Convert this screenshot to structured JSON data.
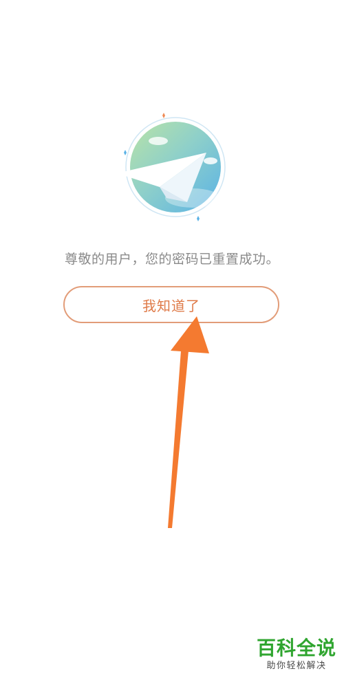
{
  "dialog": {
    "message": "尊敬的用户，您的密码已重置成功。",
    "confirm_label": "我知道了"
  },
  "watermark": {
    "title": "百科全说",
    "subtitle": "助你轻松解决"
  },
  "colors": {
    "accent": "#df7a48",
    "button_border": "#e29c78",
    "message_text": "#8a8a8a",
    "annotation_arrow": "#f47a30",
    "watermark_green": "#2fa52f"
  },
  "icons": {
    "illustration": "paper-plane-globe-icon",
    "annotation": "annotation-arrow"
  }
}
